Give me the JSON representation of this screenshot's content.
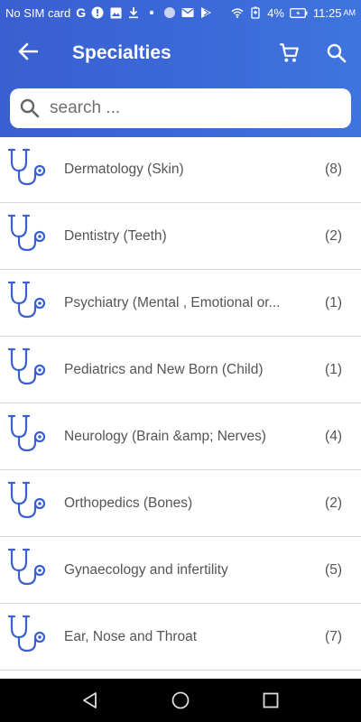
{
  "status_bar": {
    "carrier": "No SIM card",
    "battery": "4%",
    "time": "11:25",
    "ampm": "AM"
  },
  "app_bar": {
    "title": "Specialties"
  },
  "search": {
    "placeholder": "search ..."
  },
  "specialties": [
    {
      "name": "Dermatology (Skin)",
      "count": "(8)"
    },
    {
      "name": "Dentistry (Teeth)",
      "count": "(2)"
    },
    {
      "name": "Psychiatry (Mental , Emotional or...",
      "count": "(1)"
    },
    {
      "name": "Pediatrics and New Born (Child)",
      "count": "(1)"
    },
    {
      "name": "Neurology (Brain &amp; Nerves)",
      "count": "(4)"
    },
    {
      "name": "Orthopedics (Bones)",
      "count": "(2)"
    },
    {
      "name": "Gynaecology and infertility",
      "count": "(5)"
    },
    {
      "name": "Ear, Nose and Throat",
      "count": "(7)"
    }
  ],
  "colors": {
    "header": "#3b67d6",
    "icon": "#3a5fd0",
    "text": "#555555"
  }
}
